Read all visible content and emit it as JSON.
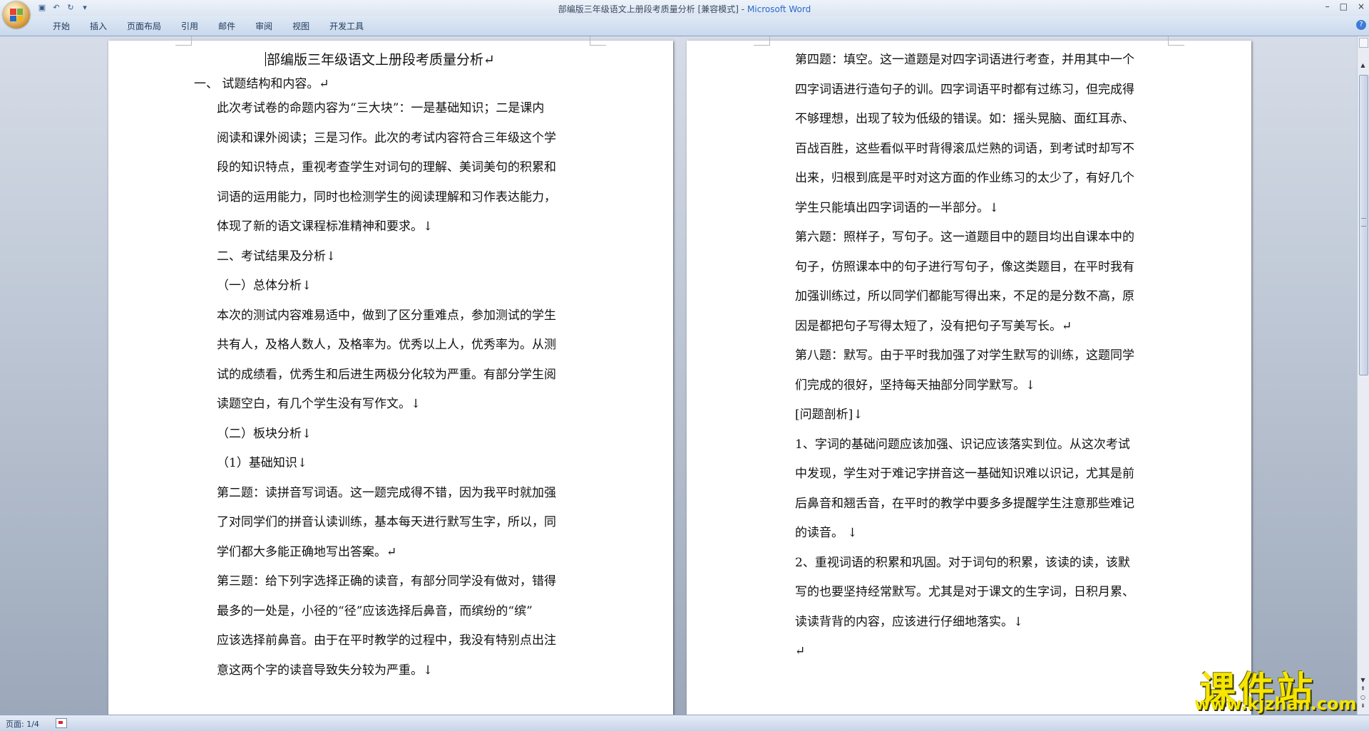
{
  "window": {
    "title": "部编版三年级语文上册段考质量分析 [兼容模式]",
    "app_name": "Microsoft Word",
    "title_separator": " - ",
    "controls": [
      "–",
      "□",
      "×"
    ]
  },
  "quick_access": {
    "icons": [
      "save-icon",
      "undo-icon",
      "redo-icon",
      "customize-icon"
    ],
    "glyphs": [
      "▣",
      "↶",
      "↻",
      "▾"
    ]
  },
  "ribbon": {
    "tabs": [
      "开始",
      "插入",
      "页面布局",
      "引用",
      "邮件",
      "审阅",
      "视图",
      "开发工具"
    ],
    "help": "?"
  },
  "document": {
    "left_page": {
      "title": "部编版三年级语文上册段考质量分析↵",
      "heading1": "一、   试题结构和内容。↵",
      "lines": [
        "此次考试卷的命题内容为“三大块”：一是基础知识；二是课内",
        "阅读和课外阅读；三是习作。此次的考试内容符合三年级这个学",
        "段的知识特点，重视考查学生对词句的理解、美词美句的积累和",
        "词语的运用能力，同时也检测学生的阅读理解和习作表达能力，",
        "体现了新的语文课程标准精神和要求。↓",
        "二、考试结果及分析↓",
        "（一）总体分析↓",
        "本次的测试内容难易适中，做到了区分重难点，参加测试的学生",
        "共有人，及格人数人，及格率为。优秀以上人，优秀率为。从测",
        "试的成绩看，优秀生和后进生两极分化较为严重。有部分学生阅",
        "读题空白，有几个学生没有写作文。↓",
        "（二）板块分析↓",
        "（1）基础知识↓",
        "第二题：读拼音写词语。这一题完成得不错，因为我平时就加强",
        "了对同学们的拼音认读训练，基本每天进行默写生字，所以，同",
        "学们都大多能正确地写出答案。↵",
        "第三题：给下列字选择正确的读音，有部分同学没有做对，错得",
        "最多的一处是，小径的“径”应该选择后鼻音，而缤纷的“缤”",
        "应该选择前鼻音。由于在平时教学的过程中，我没有特别点出注",
        "意这两个字的读音导致失分较为严重。↓"
      ]
    },
    "right_page": {
      "lines": [
        "第四题：填空。这一道题是对四字词语进行考查，并用其中一个",
        "四字词语进行造句子的训。四字词语平时都有过练习，但完成得",
        "不够理想，出现了较为低级的错误。如：摇头晃脑、面红耳赤、",
        "百战百胜，这些看似平时背得滚瓜烂熟的词语，到考试时却写不",
        "出来，归根到底是平时对这方面的作业练习的太少了，有好几个",
        "学生只能填出四字词语的一半部分。↓",
        "第六题：照样子，写句子。这一道题目中的题目均出自课本中的",
        "句子，仿照课本中的句子进行写句子，像这类题目，在平时我有",
        "加强训练过，所以同学们都能写得出来，不足的是分数不高，原",
        "因是都把句子写得太短了，没有把句子写美写长。↵",
        "第八题：默写。由于平时我加强了对学生默写的训练，这题同学",
        "们完成的很好，坚持每天抽部分同学默写。↓",
        "[问题剖析]↓",
        "1、字词的基础问题应该加强、识记应该落实到位。从这次考试",
        "中发现，学生对于难记字拼音这一基础知识难以识记，尤其是前",
        "后鼻音和翘舌音，在平时的教学中要多多提醒学生注意那些难记",
        "的读音。 ↓",
        "2、重视词语的积累和巩固。对于词句的积累，该读的读，该默",
        "写的也要坚持经常默写。尤其是对于课文的生字词，日积月累、",
        "读读背背的内容，应该进行仔细地落实。↓",
        "↵"
      ]
    }
  },
  "status_bar": {
    "page_indicator": "页面: 1/4"
  },
  "watermark": {
    "title": "课件站",
    "url": "www.kjzhan.com",
    "color": "#f6e600"
  },
  "colors": {
    "ribbon_text": "#1e395b",
    "app_name": "#2a6ac8",
    "workspace_bg": "#9ba7b8"
  }
}
